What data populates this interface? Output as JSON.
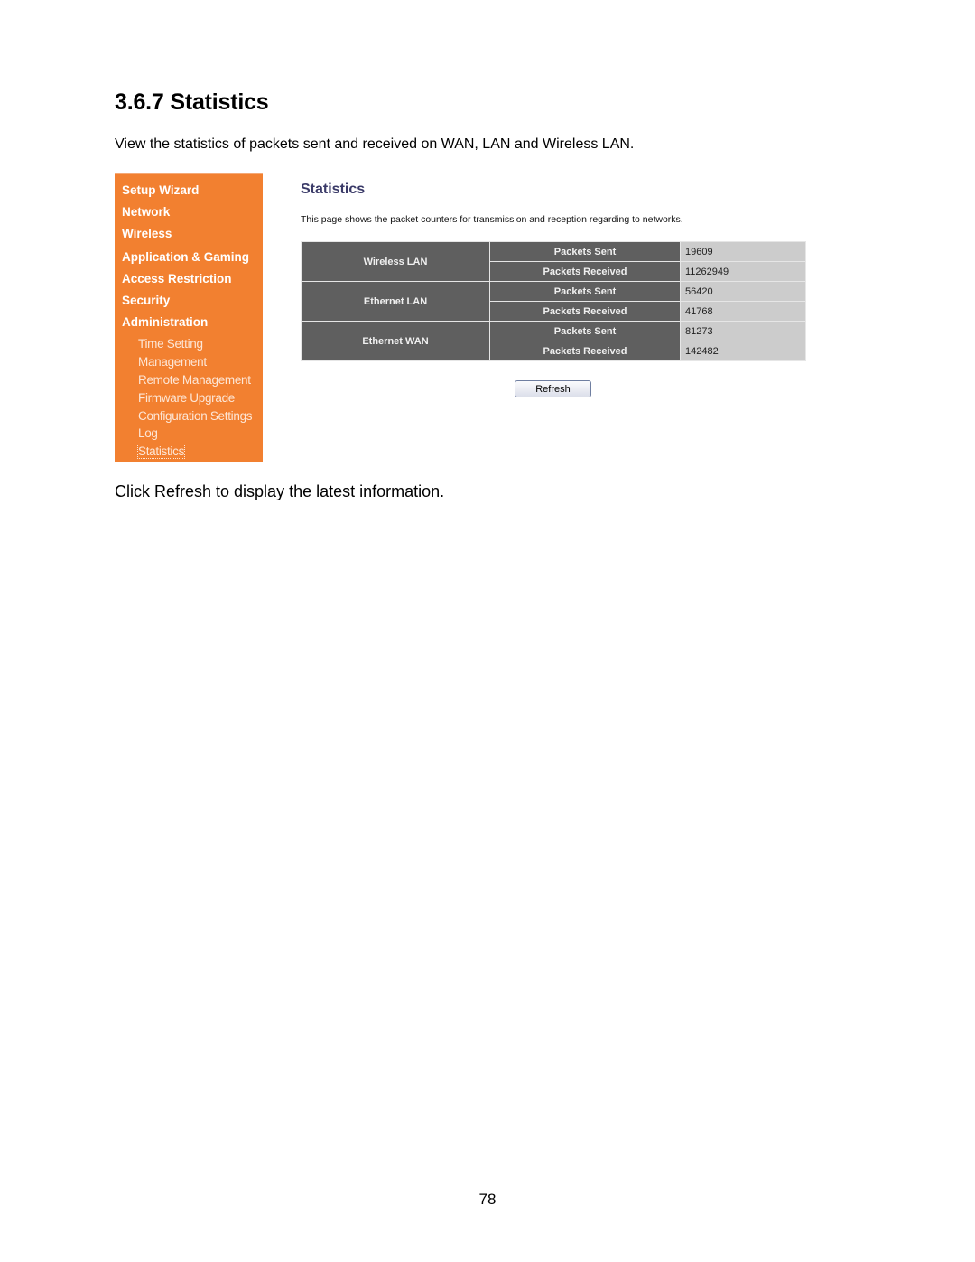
{
  "document": {
    "heading": "3.6.7 Statistics",
    "intro": "View the statistics of packets sent and received on WAN, LAN and Wireless LAN.",
    "after_text": "Click Refresh to display the latest information.",
    "page_number": "78"
  },
  "sidebar": {
    "main_items": [
      {
        "label": "Setup Wizard"
      },
      {
        "label": "Network"
      },
      {
        "label": "Wireless"
      },
      {
        "label": "Application & Gaming"
      },
      {
        "label": "Access Restriction"
      },
      {
        "label": "Security"
      },
      {
        "label": "Administration"
      }
    ],
    "sub_items": [
      {
        "label": "Time Setting"
      },
      {
        "label": "Management"
      },
      {
        "label": "Remote Management"
      },
      {
        "label": "Firmware Upgrade"
      },
      {
        "label": "Configuration Settings"
      },
      {
        "label": "Log"
      },
      {
        "label": "Statistics",
        "active": true
      }
    ]
  },
  "content": {
    "title": "Statistics",
    "description": "This page shows the packet counters for transmission and reception regarding to networks.",
    "table": [
      {
        "network": "Wireless LAN",
        "sent_label": "Packets Sent",
        "sent": "19609",
        "received_label": "Packets Received",
        "received": "11262949"
      },
      {
        "network": "Ethernet LAN",
        "sent_label": "Packets Sent",
        "sent": "56420",
        "received_label": "Packets Received",
        "received": "41768"
      },
      {
        "network": "Ethernet WAN",
        "sent_label": "Packets Sent",
        "sent": "81273",
        "received_label": "Packets Received",
        "received": "142482"
      }
    ],
    "refresh_label": "Refresh"
  },
  "colors": {
    "sidebar_bg": "#f28030",
    "table_header_bg": "#5f5f5f",
    "table_value_bg": "#cccccc",
    "title_color": "#3a3a68"
  }
}
